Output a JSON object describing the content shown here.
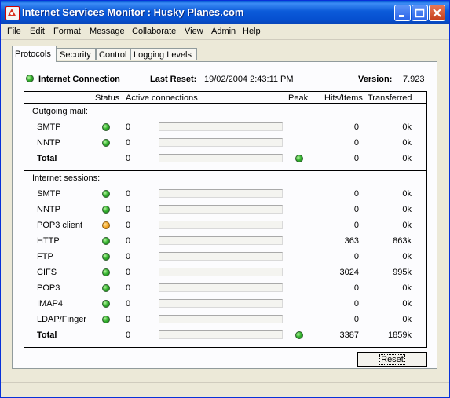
{
  "window": {
    "title": "Internet Services Monitor : Husky Planes.com",
    "buttons": [
      "minimize",
      "maximize",
      "close"
    ]
  },
  "menu": [
    "File",
    "Edit",
    "Format",
    "Message",
    "Collaborate",
    "View",
    "Admin",
    "Help"
  ],
  "tabs": [
    "Protocols",
    "Security",
    "Control",
    "Logging Levels"
  ],
  "active_tab": "Protocols",
  "header": {
    "connection_label": "Internet Connection",
    "last_reset_label": "Last Reset:",
    "last_reset_value": "19/02/2004 2:43:11 PM",
    "version_label": "Version:",
    "version_value": "7.923"
  },
  "table": {
    "columns": {
      "status": "Status",
      "active": "Active connections",
      "peak": "Peak",
      "hits": "Hits/Items",
      "transferred": "Transferred"
    },
    "outgoing": {
      "title": "Outgoing mail:",
      "rows": [
        {
          "name": "SMTP",
          "status": "green",
          "active": "0",
          "hits": "0",
          "transferred": "0k"
        },
        {
          "name": "NNTP",
          "status": "green",
          "active": "0",
          "hits": "0",
          "transferred": "0k"
        }
      ],
      "total": {
        "name": "Total",
        "active": "0",
        "peak": "green",
        "hits": "0",
        "transferred": "0k"
      }
    },
    "sessions": {
      "title": "Internet sessions:",
      "rows": [
        {
          "name": "SMTP",
          "status": "green",
          "active": "0",
          "hits": "0",
          "transferred": "0k"
        },
        {
          "name": "NNTP",
          "status": "green",
          "active": "0",
          "hits": "0",
          "transferred": "0k"
        },
        {
          "name": "POP3 client",
          "status": "orange",
          "active": "0",
          "hits": "0",
          "transferred": "0k"
        },
        {
          "name": "HTTP",
          "status": "green",
          "active": "0",
          "hits": "363",
          "transferred": "863k"
        },
        {
          "name": "FTP",
          "status": "green",
          "active": "0",
          "hits": "0",
          "transferred": "0k"
        },
        {
          "name": "CIFS",
          "status": "green",
          "active": "0",
          "hits": "3024",
          "transferred": "995k"
        },
        {
          "name": "POP3",
          "status": "green",
          "active": "0",
          "hits": "0",
          "transferred": "0k"
        },
        {
          "name": "IMAP4",
          "status": "green",
          "active": "0",
          "hits": "0",
          "transferred": "0k"
        },
        {
          "name": "LDAP/Finger",
          "status": "green",
          "active": "0",
          "hits": "0",
          "transferred": "0k"
        }
      ],
      "total": {
        "name": "Total",
        "active": "0",
        "peak": "green",
        "hits": "3387",
        "transferred": "1859k"
      }
    }
  },
  "reset_button": "Reset",
  "colors": {
    "title_bar": "#0a5fd8",
    "status_green": "#35b330",
    "status_orange": "#f5a623",
    "dialog_bg": "#ece9d8"
  }
}
